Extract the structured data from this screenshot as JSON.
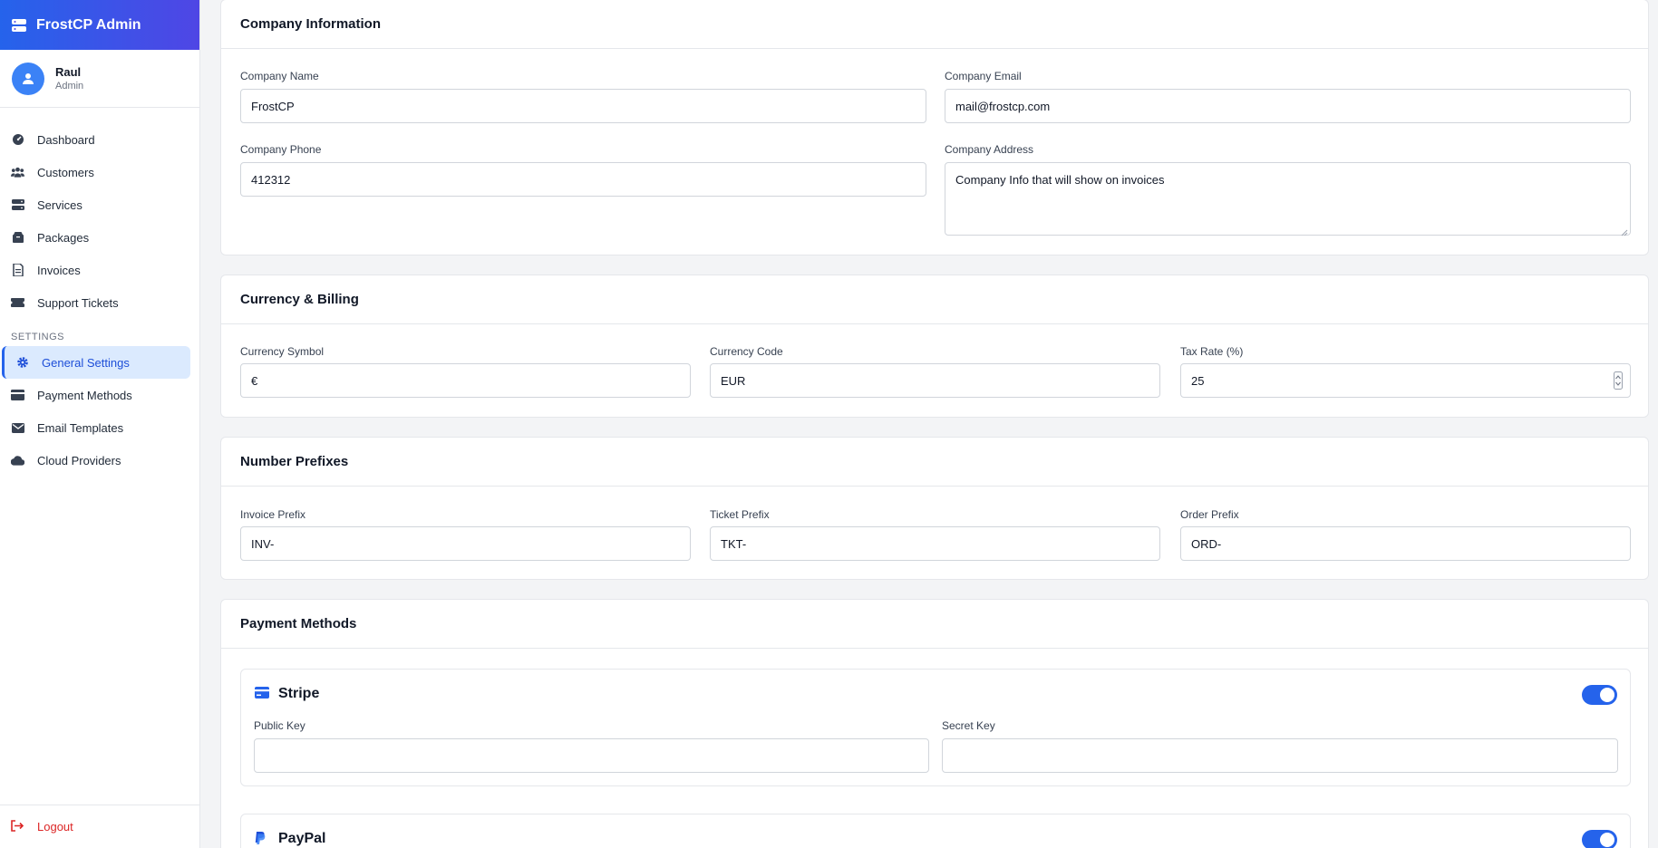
{
  "app": {
    "title": "FrostCP Admin"
  },
  "user": {
    "name": "Raul",
    "role": "Admin"
  },
  "nav": {
    "items": [
      {
        "label": "Dashboard",
        "icon": "dashboard-icon"
      },
      {
        "label": "Customers",
        "icon": "users-icon"
      },
      {
        "label": "Services",
        "icon": "server-icon"
      },
      {
        "label": "Packages",
        "icon": "box-icon"
      },
      {
        "label": "Invoices",
        "icon": "invoice-icon"
      },
      {
        "label": "Support Tickets",
        "icon": "ticket-icon"
      }
    ],
    "section_label": "SETTINGS",
    "settings_items": [
      {
        "label": "General Settings",
        "icon": "gear-icon",
        "active": true
      },
      {
        "label": "Payment Methods",
        "icon": "credit-card-icon"
      },
      {
        "label": "Email Templates",
        "icon": "envelope-icon"
      },
      {
        "label": "Cloud Providers",
        "icon": "cloud-icon"
      }
    ],
    "logout_label": "Logout"
  },
  "company": {
    "title": "Company Information",
    "name_label": "Company Name",
    "name_value": "FrostCP",
    "email_label": "Company Email",
    "email_value": "mail@frostcp.com",
    "phone_label": "Company Phone",
    "phone_value": "412312",
    "address_label": "Company Address",
    "address_value": "Company Info that will show on invoices"
  },
  "billing": {
    "title": "Currency & Billing",
    "symbol_label": "Currency Symbol",
    "symbol_value": "€",
    "code_label": "Currency Code",
    "code_value": "EUR",
    "tax_label": "Tax Rate (%)",
    "tax_value": "25"
  },
  "prefixes": {
    "title": "Number Prefixes",
    "invoice_label": "Invoice Prefix",
    "invoice_value": "INV-",
    "ticket_label": "Ticket Prefix",
    "ticket_value": "TKT-",
    "order_label": "Order Prefix",
    "order_value": "ORD-"
  },
  "payments": {
    "title": "Payment Methods",
    "stripe": {
      "name": "Stripe",
      "enabled": true,
      "public_key_label": "Public Key",
      "public_key_value": "",
      "secret_key_label": "Secret Key",
      "secret_key_value": ""
    },
    "paypal": {
      "name": "PayPal",
      "enabled": true
    }
  },
  "colors": {
    "accent": "#2563eb",
    "brand_gradient_end": "#4f46e5",
    "danger": "#dc2626"
  }
}
